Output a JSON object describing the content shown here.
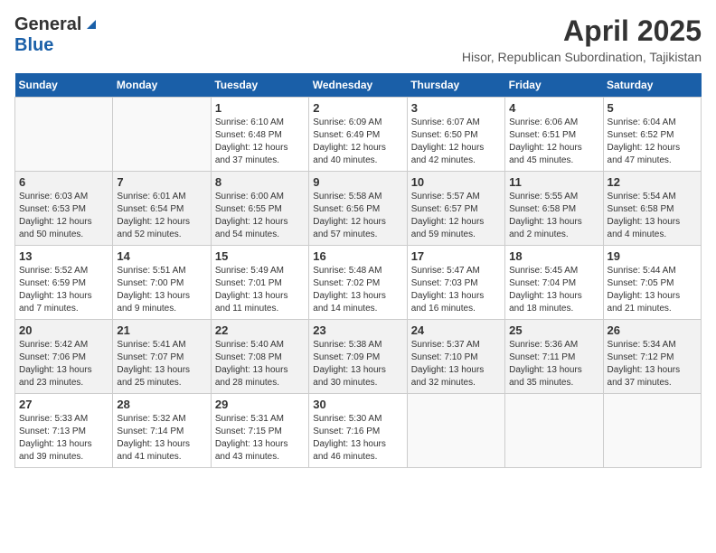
{
  "header": {
    "logo_general": "General",
    "logo_blue": "Blue",
    "month": "April 2025",
    "location": "Hisor, Republican Subordination, Tajikistan"
  },
  "columns": [
    "Sunday",
    "Monday",
    "Tuesday",
    "Wednesday",
    "Thursday",
    "Friday",
    "Saturday"
  ],
  "weeks": [
    [
      {
        "day": "",
        "sunrise": "",
        "sunset": "",
        "daylight": ""
      },
      {
        "day": "",
        "sunrise": "",
        "sunset": "",
        "daylight": ""
      },
      {
        "day": "1",
        "sunrise": "Sunrise: 6:10 AM",
        "sunset": "Sunset: 6:48 PM",
        "daylight": "Daylight: 12 hours and 37 minutes."
      },
      {
        "day": "2",
        "sunrise": "Sunrise: 6:09 AM",
        "sunset": "Sunset: 6:49 PM",
        "daylight": "Daylight: 12 hours and 40 minutes."
      },
      {
        "day": "3",
        "sunrise": "Sunrise: 6:07 AM",
        "sunset": "Sunset: 6:50 PM",
        "daylight": "Daylight: 12 hours and 42 minutes."
      },
      {
        "day": "4",
        "sunrise": "Sunrise: 6:06 AM",
        "sunset": "Sunset: 6:51 PM",
        "daylight": "Daylight: 12 hours and 45 minutes."
      },
      {
        "day": "5",
        "sunrise": "Sunrise: 6:04 AM",
        "sunset": "Sunset: 6:52 PM",
        "daylight": "Daylight: 12 hours and 47 minutes."
      }
    ],
    [
      {
        "day": "6",
        "sunrise": "Sunrise: 6:03 AM",
        "sunset": "Sunset: 6:53 PM",
        "daylight": "Daylight: 12 hours and 50 minutes."
      },
      {
        "day": "7",
        "sunrise": "Sunrise: 6:01 AM",
        "sunset": "Sunset: 6:54 PM",
        "daylight": "Daylight: 12 hours and 52 minutes."
      },
      {
        "day": "8",
        "sunrise": "Sunrise: 6:00 AM",
        "sunset": "Sunset: 6:55 PM",
        "daylight": "Daylight: 12 hours and 54 minutes."
      },
      {
        "day": "9",
        "sunrise": "Sunrise: 5:58 AM",
        "sunset": "Sunset: 6:56 PM",
        "daylight": "Daylight: 12 hours and 57 minutes."
      },
      {
        "day": "10",
        "sunrise": "Sunrise: 5:57 AM",
        "sunset": "Sunset: 6:57 PM",
        "daylight": "Daylight: 12 hours and 59 minutes."
      },
      {
        "day": "11",
        "sunrise": "Sunrise: 5:55 AM",
        "sunset": "Sunset: 6:58 PM",
        "daylight": "Daylight: 13 hours and 2 minutes."
      },
      {
        "day": "12",
        "sunrise": "Sunrise: 5:54 AM",
        "sunset": "Sunset: 6:58 PM",
        "daylight": "Daylight: 13 hours and 4 minutes."
      }
    ],
    [
      {
        "day": "13",
        "sunrise": "Sunrise: 5:52 AM",
        "sunset": "Sunset: 6:59 PM",
        "daylight": "Daylight: 13 hours and 7 minutes."
      },
      {
        "day": "14",
        "sunrise": "Sunrise: 5:51 AM",
        "sunset": "Sunset: 7:00 PM",
        "daylight": "Daylight: 13 hours and 9 minutes."
      },
      {
        "day": "15",
        "sunrise": "Sunrise: 5:49 AM",
        "sunset": "Sunset: 7:01 PM",
        "daylight": "Daylight: 13 hours and 11 minutes."
      },
      {
        "day": "16",
        "sunrise": "Sunrise: 5:48 AM",
        "sunset": "Sunset: 7:02 PM",
        "daylight": "Daylight: 13 hours and 14 minutes."
      },
      {
        "day": "17",
        "sunrise": "Sunrise: 5:47 AM",
        "sunset": "Sunset: 7:03 PM",
        "daylight": "Daylight: 13 hours and 16 minutes."
      },
      {
        "day": "18",
        "sunrise": "Sunrise: 5:45 AM",
        "sunset": "Sunset: 7:04 PM",
        "daylight": "Daylight: 13 hours and 18 minutes."
      },
      {
        "day": "19",
        "sunrise": "Sunrise: 5:44 AM",
        "sunset": "Sunset: 7:05 PM",
        "daylight": "Daylight: 13 hours and 21 minutes."
      }
    ],
    [
      {
        "day": "20",
        "sunrise": "Sunrise: 5:42 AM",
        "sunset": "Sunset: 7:06 PM",
        "daylight": "Daylight: 13 hours and 23 minutes."
      },
      {
        "day": "21",
        "sunrise": "Sunrise: 5:41 AM",
        "sunset": "Sunset: 7:07 PM",
        "daylight": "Daylight: 13 hours and 25 minutes."
      },
      {
        "day": "22",
        "sunrise": "Sunrise: 5:40 AM",
        "sunset": "Sunset: 7:08 PM",
        "daylight": "Daylight: 13 hours and 28 minutes."
      },
      {
        "day": "23",
        "sunrise": "Sunrise: 5:38 AM",
        "sunset": "Sunset: 7:09 PM",
        "daylight": "Daylight: 13 hours and 30 minutes."
      },
      {
        "day": "24",
        "sunrise": "Sunrise: 5:37 AM",
        "sunset": "Sunset: 7:10 PM",
        "daylight": "Daylight: 13 hours and 32 minutes."
      },
      {
        "day": "25",
        "sunrise": "Sunrise: 5:36 AM",
        "sunset": "Sunset: 7:11 PM",
        "daylight": "Daylight: 13 hours and 35 minutes."
      },
      {
        "day": "26",
        "sunrise": "Sunrise: 5:34 AM",
        "sunset": "Sunset: 7:12 PM",
        "daylight": "Daylight: 13 hours and 37 minutes."
      }
    ],
    [
      {
        "day": "27",
        "sunrise": "Sunrise: 5:33 AM",
        "sunset": "Sunset: 7:13 PM",
        "daylight": "Daylight: 13 hours and 39 minutes."
      },
      {
        "day": "28",
        "sunrise": "Sunrise: 5:32 AM",
        "sunset": "Sunset: 7:14 PM",
        "daylight": "Daylight: 13 hours and 41 minutes."
      },
      {
        "day": "29",
        "sunrise": "Sunrise: 5:31 AM",
        "sunset": "Sunset: 7:15 PM",
        "daylight": "Daylight: 13 hours and 43 minutes."
      },
      {
        "day": "30",
        "sunrise": "Sunrise: 5:30 AM",
        "sunset": "Sunset: 7:16 PM",
        "daylight": "Daylight: 13 hours and 46 minutes."
      },
      {
        "day": "",
        "sunrise": "",
        "sunset": "",
        "daylight": ""
      },
      {
        "day": "",
        "sunrise": "",
        "sunset": "",
        "daylight": ""
      },
      {
        "day": "",
        "sunrise": "",
        "sunset": "",
        "daylight": ""
      }
    ]
  ]
}
